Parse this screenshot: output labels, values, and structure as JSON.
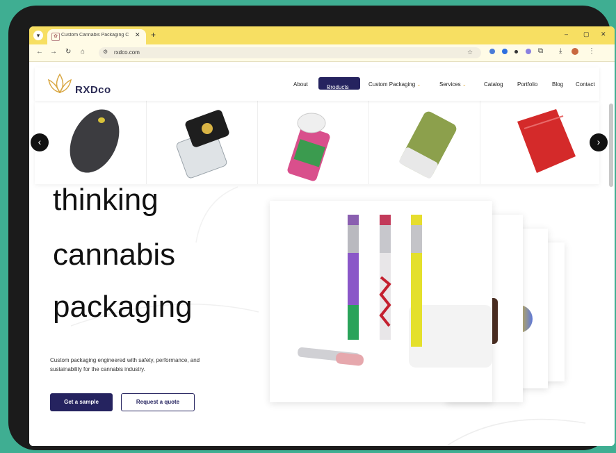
{
  "browser": {
    "tab_title": "Custom Cannabis Packaging C",
    "tab_close": "✕",
    "new_tab": "+",
    "url": "rxdco.com",
    "window_controls": {
      "minimize": "–",
      "maximize": "▢",
      "close": "✕"
    }
  },
  "site": {
    "logo_text": "RXDco",
    "nav": {
      "about": "About",
      "products": "Products",
      "custom_packaging": "Custom Packaging",
      "services": "Services",
      "catalog": "Catalog",
      "portfolio": "Portfolio",
      "blog": "Blog",
      "contact": "Contact"
    },
    "carousel_products": [
      "pebble-vape-battery-icon",
      "glass-jar-icon",
      "pop-top-tube-icon",
      "slider-tin-icon",
      "mylar-bag-icon"
    ]
  },
  "hero": {
    "line1": "thinking",
    "line2": "cannabis",
    "line3": "packaging",
    "description": "Custom packaging engineered with safety, performance, and sustainability for the cannabis industry.",
    "primary_cta": "Get a sample",
    "secondary_cta": "Request a quote"
  },
  "colors": {
    "brand_navy": "#25235f",
    "tab_strip": "#f7df62",
    "device_background": "#3fae92"
  }
}
